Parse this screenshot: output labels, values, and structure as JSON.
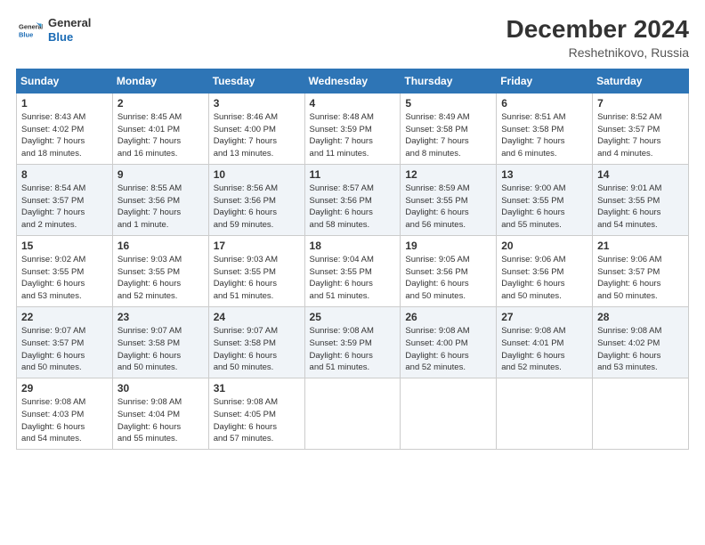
{
  "logo": {
    "line1": "General",
    "line2": "Blue"
  },
  "title": "December 2024",
  "subtitle": "Reshetnikovo, Russia",
  "days_of_week": [
    "Sunday",
    "Monday",
    "Tuesday",
    "Wednesday",
    "Thursday",
    "Friday",
    "Saturday"
  ],
  "weeks": [
    [
      {
        "day": "1",
        "info": "Sunrise: 8:43 AM\nSunset: 4:02 PM\nDaylight: 7 hours\nand 18 minutes."
      },
      {
        "day": "2",
        "info": "Sunrise: 8:45 AM\nSunset: 4:01 PM\nDaylight: 7 hours\nand 16 minutes."
      },
      {
        "day": "3",
        "info": "Sunrise: 8:46 AM\nSunset: 4:00 PM\nDaylight: 7 hours\nand 13 minutes."
      },
      {
        "day": "4",
        "info": "Sunrise: 8:48 AM\nSunset: 3:59 PM\nDaylight: 7 hours\nand 11 minutes."
      },
      {
        "day": "5",
        "info": "Sunrise: 8:49 AM\nSunset: 3:58 PM\nDaylight: 7 hours\nand 8 minutes."
      },
      {
        "day": "6",
        "info": "Sunrise: 8:51 AM\nSunset: 3:58 PM\nDaylight: 7 hours\nand 6 minutes."
      },
      {
        "day": "7",
        "info": "Sunrise: 8:52 AM\nSunset: 3:57 PM\nDaylight: 7 hours\nand 4 minutes."
      }
    ],
    [
      {
        "day": "8",
        "info": "Sunrise: 8:54 AM\nSunset: 3:57 PM\nDaylight: 7 hours\nand 2 minutes."
      },
      {
        "day": "9",
        "info": "Sunrise: 8:55 AM\nSunset: 3:56 PM\nDaylight: 7 hours\nand 1 minute."
      },
      {
        "day": "10",
        "info": "Sunrise: 8:56 AM\nSunset: 3:56 PM\nDaylight: 6 hours\nand 59 minutes."
      },
      {
        "day": "11",
        "info": "Sunrise: 8:57 AM\nSunset: 3:56 PM\nDaylight: 6 hours\nand 58 minutes."
      },
      {
        "day": "12",
        "info": "Sunrise: 8:59 AM\nSunset: 3:55 PM\nDaylight: 6 hours\nand 56 minutes."
      },
      {
        "day": "13",
        "info": "Sunrise: 9:00 AM\nSunset: 3:55 PM\nDaylight: 6 hours\nand 55 minutes."
      },
      {
        "day": "14",
        "info": "Sunrise: 9:01 AM\nSunset: 3:55 PM\nDaylight: 6 hours\nand 54 minutes."
      }
    ],
    [
      {
        "day": "15",
        "info": "Sunrise: 9:02 AM\nSunset: 3:55 PM\nDaylight: 6 hours\nand 53 minutes."
      },
      {
        "day": "16",
        "info": "Sunrise: 9:03 AM\nSunset: 3:55 PM\nDaylight: 6 hours\nand 52 minutes."
      },
      {
        "day": "17",
        "info": "Sunrise: 9:03 AM\nSunset: 3:55 PM\nDaylight: 6 hours\nand 51 minutes."
      },
      {
        "day": "18",
        "info": "Sunrise: 9:04 AM\nSunset: 3:55 PM\nDaylight: 6 hours\nand 51 minutes."
      },
      {
        "day": "19",
        "info": "Sunrise: 9:05 AM\nSunset: 3:56 PM\nDaylight: 6 hours\nand 50 minutes."
      },
      {
        "day": "20",
        "info": "Sunrise: 9:06 AM\nSunset: 3:56 PM\nDaylight: 6 hours\nand 50 minutes."
      },
      {
        "day": "21",
        "info": "Sunrise: 9:06 AM\nSunset: 3:57 PM\nDaylight: 6 hours\nand 50 minutes."
      }
    ],
    [
      {
        "day": "22",
        "info": "Sunrise: 9:07 AM\nSunset: 3:57 PM\nDaylight: 6 hours\nand 50 minutes."
      },
      {
        "day": "23",
        "info": "Sunrise: 9:07 AM\nSunset: 3:58 PM\nDaylight: 6 hours\nand 50 minutes."
      },
      {
        "day": "24",
        "info": "Sunrise: 9:07 AM\nSunset: 3:58 PM\nDaylight: 6 hours\nand 50 minutes."
      },
      {
        "day": "25",
        "info": "Sunrise: 9:08 AM\nSunset: 3:59 PM\nDaylight: 6 hours\nand 51 minutes."
      },
      {
        "day": "26",
        "info": "Sunrise: 9:08 AM\nSunset: 4:00 PM\nDaylight: 6 hours\nand 52 minutes."
      },
      {
        "day": "27",
        "info": "Sunrise: 9:08 AM\nSunset: 4:01 PM\nDaylight: 6 hours\nand 52 minutes."
      },
      {
        "day": "28",
        "info": "Sunrise: 9:08 AM\nSunset: 4:02 PM\nDaylight: 6 hours\nand 53 minutes."
      }
    ],
    [
      {
        "day": "29",
        "info": "Sunrise: 9:08 AM\nSunset: 4:03 PM\nDaylight: 6 hours\nand 54 minutes."
      },
      {
        "day": "30",
        "info": "Sunrise: 9:08 AM\nSunset: 4:04 PM\nDaylight: 6 hours\nand 55 minutes."
      },
      {
        "day": "31",
        "info": "Sunrise: 9:08 AM\nSunset: 4:05 PM\nDaylight: 6 hours\nand 57 minutes."
      },
      {
        "day": "",
        "info": ""
      },
      {
        "day": "",
        "info": ""
      },
      {
        "day": "",
        "info": ""
      },
      {
        "day": "",
        "info": ""
      }
    ]
  ]
}
